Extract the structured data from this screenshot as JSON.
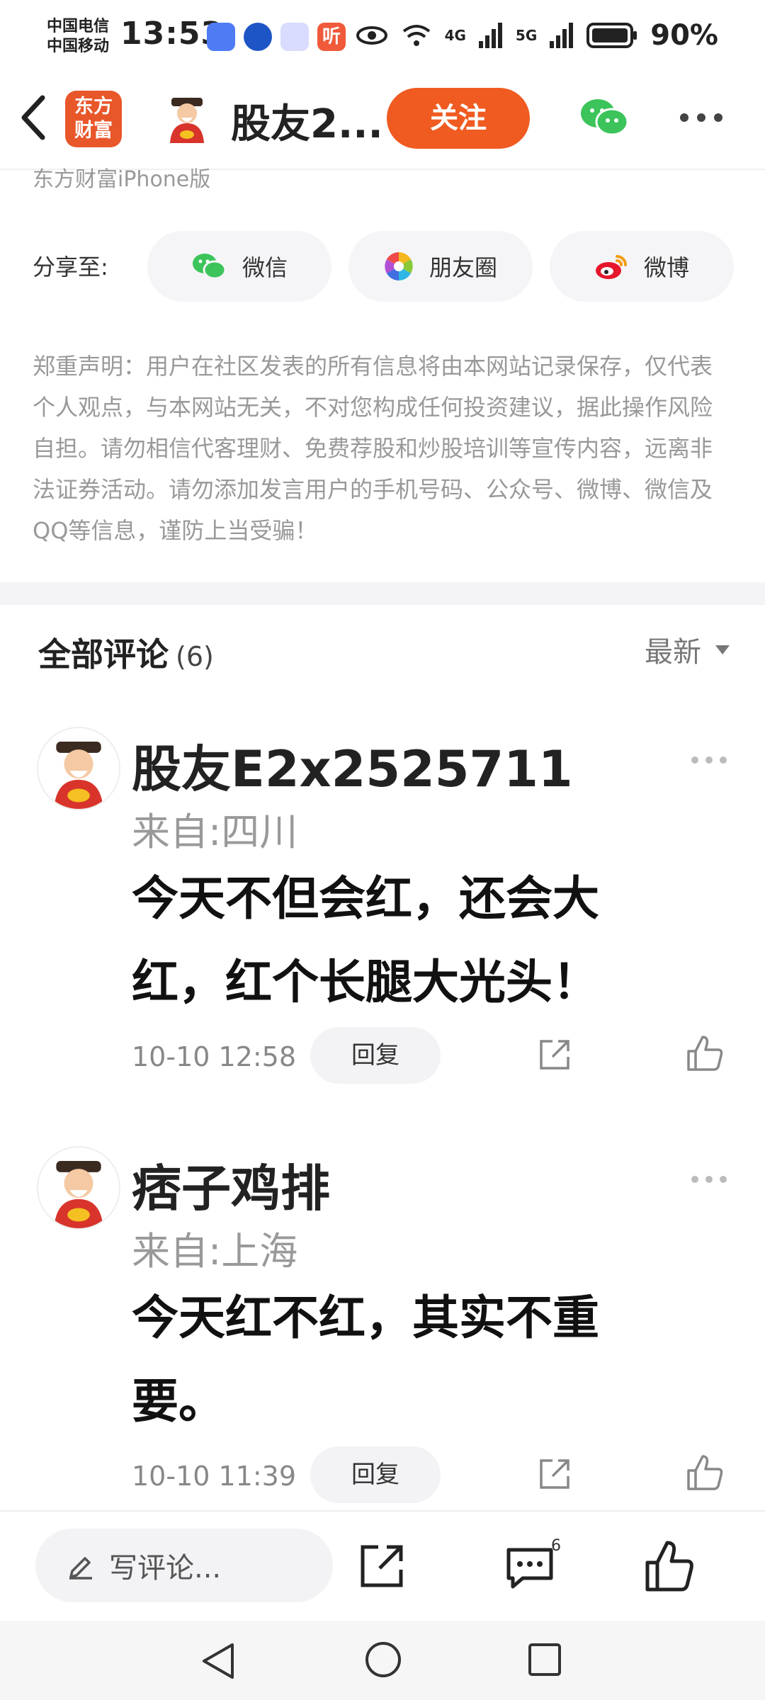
{
  "status_bar": {
    "carrier_1": "中国电信",
    "carrier_2": "中国移动",
    "time": "13:53",
    "net_left": "4G",
    "net_right": "5G",
    "battery": "90%",
    "app_icon_4": "听"
  },
  "header": {
    "logo_line1": "东方",
    "logo_line2": "财富",
    "title": "股友2...",
    "follow_label": "关注"
  },
  "post": {
    "source": "东方财富iPhone版",
    "share_label": "分享至:",
    "share_options": [
      {
        "label": "微信",
        "icon": "wechat-icon"
      },
      {
        "label": "朋友圈",
        "icon": "moments-icon"
      },
      {
        "label": "微博",
        "icon": "weibo-icon"
      }
    ],
    "disclaimer": "郑重声明：用户在社区发表的所有信息将由本网站记录保存，仅代表个人观点，与本网站无关，不对您构成任何投资建议，据此操作风险自担。请勿相信代客理财、免费荐股和炒股培训等宣传内容，远离非法证券活动。请勿添加发言用户的手机号码、公众号、微博、微信及QQ等信息，谨防上当受骗！"
  },
  "comments_section": {
    "title": "全部评论",
    "count": "(6)",
    "sort_label": "最新",
    "items": [
      {
        "name": "股友E2x2525711",
        "location": "来自:四川",
        "text": "今天不但会红，还会大红，红个长腿大光头！",
        "time": "10-10 12:58",
        "reply_label": "回复"
      },
      {
        "name": "痞子鸡排",
        "location": "来自:上海",
        "text": "今天红不红，其实不重要。",
        "time": "10-10 11:39",
        "reply_label": "回复"
      }
    ]
  },
  "bottom_bar": {
    "write_placeholder": "写评论...",
    "comment_badge": "6"
  },
  "colors": {
    "accent": "#ef5b21",
    "muted_text": "#999999",
    "pill_bg": "#f3f3f5"
  }
}
